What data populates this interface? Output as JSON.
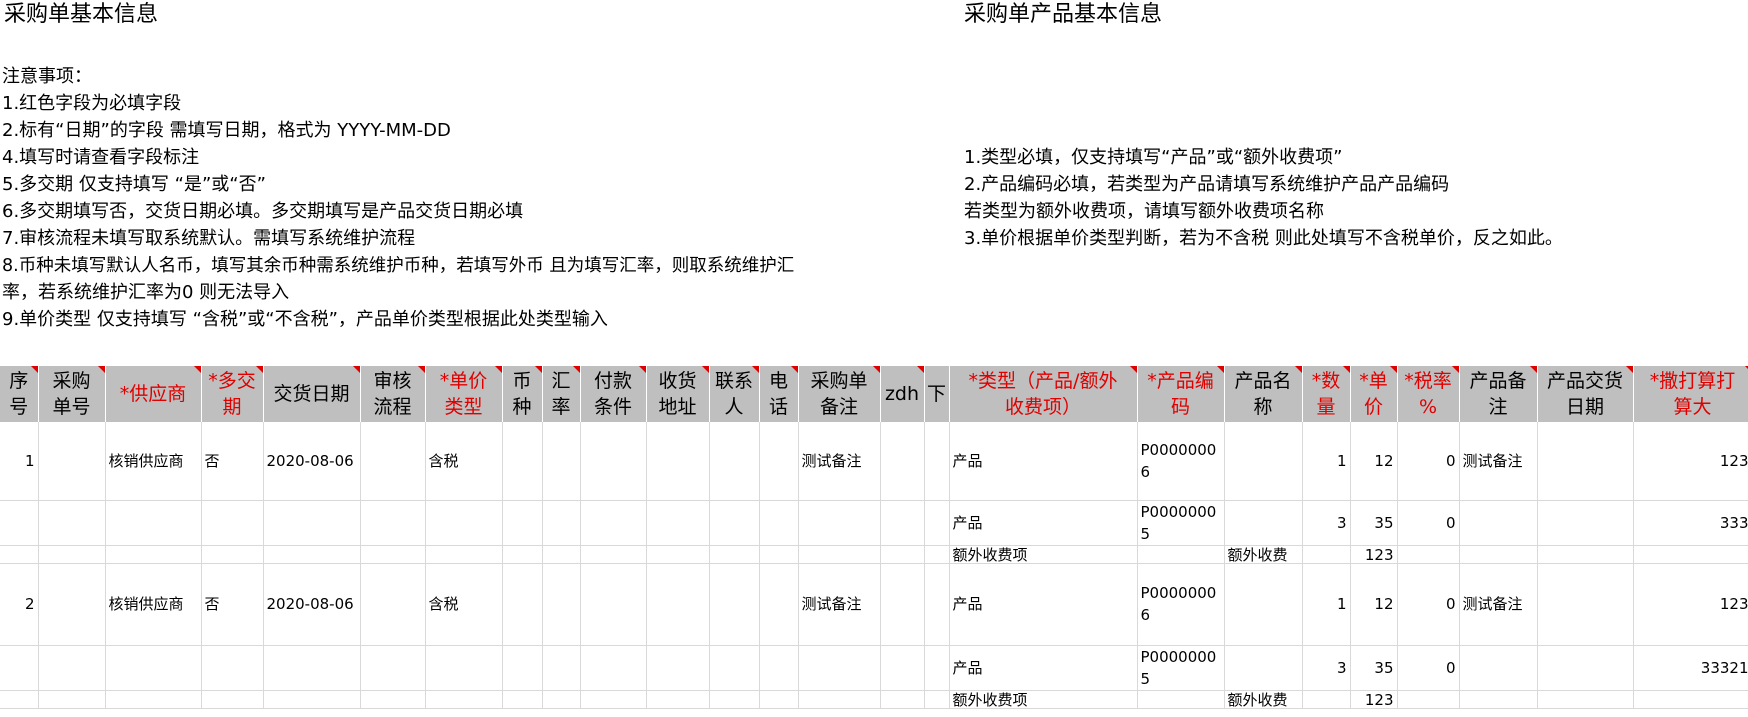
{
  "left_title": "采购单基本信息",
  "right_title": "采购单产品基本信息",
  "notes_left": [
    "注意事项：",
    "1.红色字段为必填字段",
    "2.标有“日期”的字段 需填写日期，格式为 YYYY-MM-DD",
    "4.填写时请查看字段标注",
    "5.多交期 仅支持填写 “是”或“否”",
    "6.多交期填写否，交货日期必填。多交期填写是产品交货日期必填",
    "7.审核流程未填写取系统默认。需填写系统维护流程",
    "8.币种未填写默认人名币，填写其余币种需系统维护币种，若填写外币 且为填写汇率，则取系统维护汇",
    "率，若系统维护汇率为0 则无法导入",
    "9.单价类型 仅支持填写 “含税”或“不含税”，产品单价类型根据此处类型输入"
  ],
  "notes_right": [
    "1.类型必填，仅支持填写“产品”或“额外收费项”",
    "2.产品编码必填，若类型为产品请填写系统维护产品产品编码",
    "若类型为额外收费项，请填写额外收费项名称",
    "3.单价根据单价类型判断，若为不含税 则此处填写不含税单价，反之如此。"
  ],
  "headers": [
    "序号",
    "采购单号",
    "*供应商",
    "*多交期",
    "交货日期",
    "审核流程",
    "*单价类型",
    "币种",
    "汇率",
    "付款条件",
    "收货地址",
    "联系人",
    "电话",
    "采购单备注",
    "zdh",
    "下",
    "*类型（产品/额外收费项）",
    "*产品编码",
    "产品名称",
    "*数量",
    "*单价",
    "*税率%",
    "产品备注",
    "产品交货日期",
    "*撒打算打算大"
  ],
  "header_lines": [
    [
      "序",
      "号"
    ],
    [
      "采购",
      "单号"
    ],
    [
      "*供应商"
    ],
    [
      "*多交",
      "期"
    ],
    [
      "交货日期"
    ],
    [
      "审核",
      "流程"
    ],
    [
      "*单价",
      "类型"
    ],
    [
      "币",
      "种"
    ],
    [
      "汇",
      "率"
    ],
    [
      "付款",
      "条件"
    ],
    [
      "收货",
      "地址"
    ],
    [
      "联系",
      "人"
    ],
    [
      "电",
      "话"
    ],
    [
      "采购单",
      "备注"
    ],
    [
      "zdh"
    ],
    [
      "下"
    ],
    [
      "*类型（产品/额外",
      "收费项）"
    ],
    [
      "*产品编",
      "码"
    ],
    [
      "产品名",
      "称"
    ],
    [
      "*数",
      "量"
    ],
    [
      "*单",
      "价"
    ],
    [
      "*税率",
      "%"
    ],
    [
      "产品备",
      "注"
    ],
    [
      "产品交货",
      "日期"
    ],
    [
      "*撒打算打",
      "算大"
    ]
  ],
  "required_cols": [
    2,
    3,
    6,
    16,
    17,
    19,
    20,
    21,
    24
  ],
  "marked_cols": [
    0,
    1,
    2,
    3,
    4,
    5,
    6,
    7,
    8,
    9,
    10,
    11,
    12,
    13,
    14,
    16,
    17,
    18,
    19,
    20,
    21,
    22,
    23,
    24
  ],
  "rows": [
    [
      "1",
      "",
      "核销供应商",
      "否",
      "2020-08-06",
      "",
      "含税",
      "",
      "",
      "",
      "",
      "",
      "",
      "测试备注",
      "",
      "",
      "产品",
      "P00000006",
      "",
      "1",
      "12",
      "0",
      "测试备注",
      "",
      "123"
    ],
    [
      "",
      "",
      "",
      "",
      "",
      "",
      "",
      "",
      "",
      "",
      "",
      "",
      "",
      "",
      "",
      "",
      "产品",
      "P00000005",
      "",
      "3",
      "35",
      "0",
      "",
      "",
      "333"
    ],
    [
      "",
      "",
      "",
      "",
      "",
      "",
      "",
      "",
      "",
      "",
      "",
      "",
      "",
      "",
      "",
      "",
      "额外收费项",
      "",
      "额外收费",
      "",
      "123",
      "",
      "",
      "",
      ""
    ],
    [
      "2",
      "",
      "核销供应商",
      "否",
      "2020-08-06",
      "",
      "含税",
      "",
      "",
      "",
      "",
      "",
      "",
      "测试备注",
      "",
      "",
      "产品",
      "P00000006",
      "",
      "1",
      "12",
      "0",
      "测试备注",
      "",
      "123"
    ],
    [
      "",
      "",
      "",
      "",
      "",
      "",
      "",
      "",
      "",
      "",
      "",
      "",
      "",
      "",
      "",
      "",
      "产品",
      "P00000005",
      "",
      "3",
      "35",
      "0",
      "",
      "",
      "33321"
    ],
    [
      "",
      "",
      "",
      "",
      "",
      "",
      "",
      "",
      "",
      "",
      "",
      "",
      "",
      "",
      "",
      "",
      "额外收费项",
      "",
      "额外收费",
      "",
      "123",
      "",
      "",
      "",
      ""
    ]
  ]
}
